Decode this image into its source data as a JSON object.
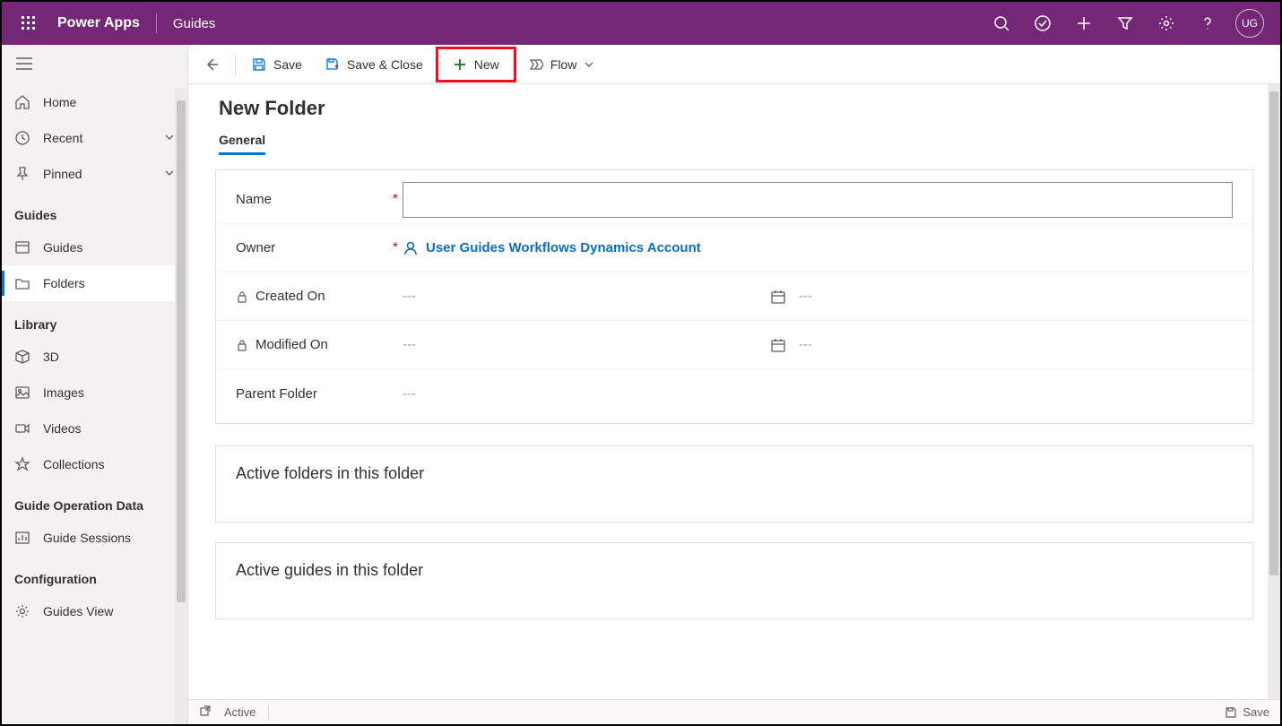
{
  "topbar": {
    "brand": "Power Apps",
    "appname": "Guides",
    "avatar_initials": "UG"
  },
  "sidebar": {
    "home": "Home",
    "recent": "Recent",
    "pinned": "Pinned",
    "section_guides": "Guides",
    "guides": "Guides",
    "folders": "Folders",
    "section_library": "Library",
    "three_d": "3D",
    "images": "Images",
    "videos": "Videos",
    "collections": "Collections",
    "section_opdata": "Guide Operation Data",
    "guide_sessions": "Guide Sessions",
    "section_config": "Configuration",
    "guides_view": "Guides View"
  },
  "cmdbar": {
    "save": "Save",
    "save_close": "Save & Close",
    "new": "New",
    "flow": "Flow"
  },
  "page": {
    "title": "New Folder",
    "tab_general": "General"
  },
  "form": {
    "name_label": "Name",
    "owner_label": "Owner",
    "owner_value": "User Guides Workflows Dynamics Account",
    "created_on_label": "Created On",
    "modified_on_label": "Modified On",
    "parent_folder_label": "Parent Folder",
    "dash": "---",
    "name_value": ""
  },
  "sections": {
    "active_folders": "Active folders in this folder",
    "active_guides": "Active guides in this folder"
  },
  "statusbar": {
    "status": "Active",
    "save": "Save"
  }
}
